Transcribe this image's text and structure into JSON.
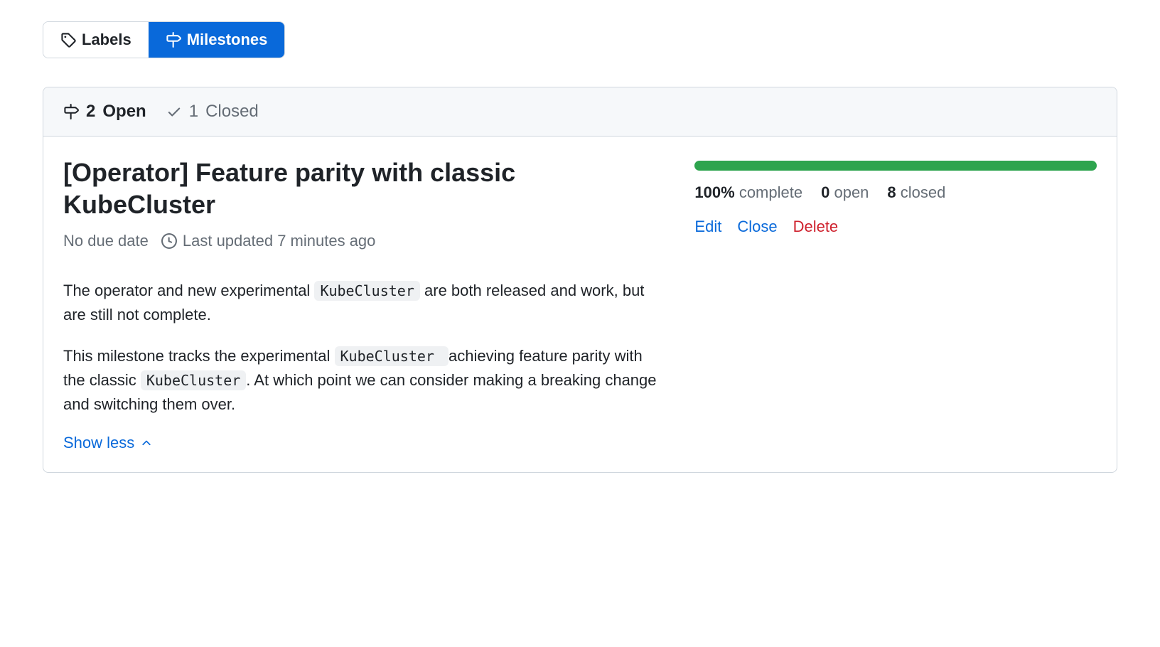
{
  "tabs": {
    "labels": "Labels",
    "milestones": "Milestones"
  },
  "counts": {
    "open_count": "2",
    "open_label": "Open",
    "closed_count": "1",
    "closed_label": "Closed"
  },
  "milestone": {
    "title": "[Operator] Feature parity with classic KubeCluster",
    "due": "No due date",
    "updated": "Last updated 7 minutes ago",
    "description": {
      "p1_prefix": "The operator and new experimental ",
      "p1_code": "KubeCluster",
      "p1_suffix": " are both released and work, but are still not complete.",
      "p2_prefix": "This milestone tracks the experimental ",
      "p2_code1": "KubeCluster ",
      "p2_mid": "achieving feature parity with the classic ",
      "p2_code2": "KubeCluster",
      "p2_suffix": ". At which point we can consider making a breaking change and switching them over."
    },
    "show_less": "Show less",
    "progress_percent": 100,
    "stats": {
      "complete_value": "100%",
      "complete_label": "complete",
      "open_value": "0",
      "open_label": "open",
      "closed_value": "8",
      "closed_label": "closed"
    },
    "actions": {
      "edit": "Edit",
      "close": "Close",
      "delete": "Delete"
    }
  }
}
